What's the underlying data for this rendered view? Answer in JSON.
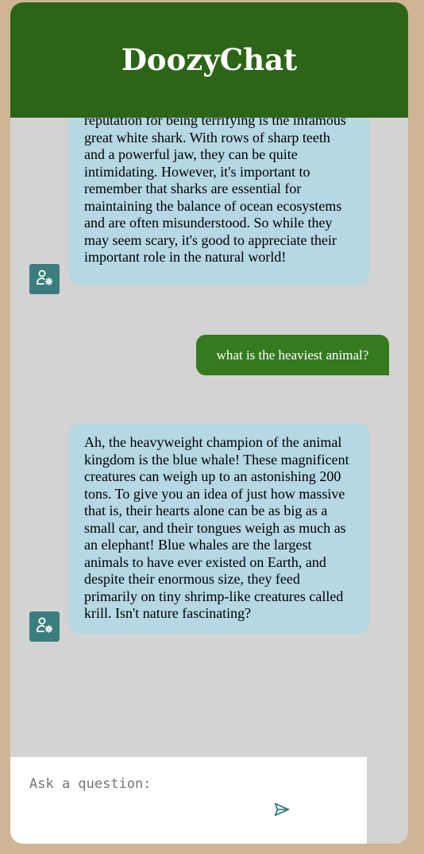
{
  "app": {
    "title": "DoozyChat"
  },
  "messages": [
    {
      "role": "bot",
      "partial_top_line": "reputation for being terrifying is the infamous",
      "text": "great white shark. With rows of sharp teeth and a powerful jaw, they can be quite intimidating. However, it's important to remember that sharks are essential for maintaining the balance of ocean ecosystems and are often misunderstood. So while they may seem scary, it's good to appreciate their important role in the natural world!",
      "avatar_icon": "user-gear-icon"
    },
    {
      "role": "user",
      "text": "what is the heaviest animal?"
    },
    {
      "role": "bot",
      "text": "Ah, the heavyweight champion of the animal kingdom is the blue whale! These magnificent creatures can weigh up to an astonishing 200 tons. To give you an idea of just how massive that is, their hearts alone can be as big as a small car, and their tongues weigh as much as an elephant! Blue whales are the largest animals to have ever existed on Earth, and despite their enormous size, they feed primarily on tiny shrimp-like creatures called krill. Isn't nature fascinating?",
      "avatar_icon": "user-gear-icon"
    }
  ],
  "input": {
    "placeholder": "Ask a question:",
    "value": "",
    "send_icon": "send-icon"
  },
  "colors": {
    "background": "#cfb593",
    "header": "#2c6517",
    "chat_area": "#d3d3d3",
    "bot_bubble": "#b6d7e4",
    "user_bubble": "#357a1f",
    "avatar": "#3a7d7c",
    "send_icon": "#3a7d7c"
  }
}
